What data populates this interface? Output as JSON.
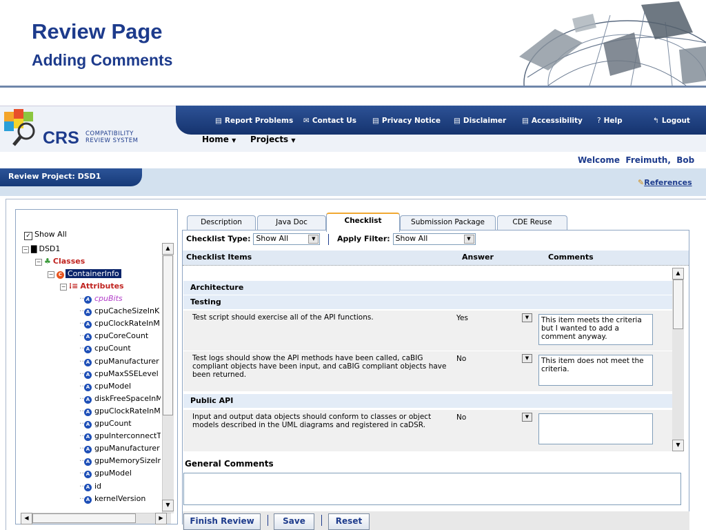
{
  "slide": {
    "title": "Review Page",
    "subtitle": "Adding Comments"
  },
  "brand": {
    "logo_text": "CRS",
    "logo_sub1": "COMPATIBILITY",
    "logo_sub2": "REVIEW SYSTEM",
    "header_blue": "#1d3b8c",
    "nav_blue": "#1f4387"
  },
  "topnav": {
    "report": "Report Problems",
    "contact": "Contact Us",
    "privacy": "Privacy Notice",
    "disclaimer": "Disclaimer",
    "accessibility": "Accessibility",
    "help": "Help",
    "logout": "Logout"
  },
  "menu": {
    "home": "Home",
    "projects": "Projects"
  },
  "welcome": "Welcome  Freimuth,  Bob",
  "project": {
    "title": "Review Project: DSD1",
    "references": "References"
  },
  "tree": {
    "show_all": "Show All",
    "root": "DSD1",
    "classes": "Classes",
    "selected_class": "ContainerInfo",
    "attributes_label": "Attributes",
    "attributes": [
      "cpuBits",
      "cpuCacheSizeInK",
      "cpuClockRateInM",
      "cpuCoreCount",
      "cpuCount",
      "cpuManufacturer",
      "cpuMaxSSELevel",
      "cpuModel",
      "diskFreeSpaceInM",
      "gpuClockRateInM",
      "gpuCount",
      "gpuInterconnectT",
      "gpuManufacturer",
      "gpuMemorySizeIr",
      "gpuModel",
      "id",
      "kernelVersion"
    ]
  },
  "tabs": [
    "Description",
    "Java Doc",
    "Checklist",
    "Submission Package",
    "CDE Reuse"
  ],
  "filters": {
    "type_label": "Checklist Type:",
    "type_value": "Show All",
    "filter_label": "Apply Filter:",
    "filter_value": "Show All"
  },
  "columns": {
    "items": "Checklist Items",
    "answer": "Answer",
    "comments": "Comments"
  },
  "sections": {
    "architecture": "Architecture",
    "testing": "Testing",
    "public_api": "Public API"
  },
  "items": [
    {
      "text": "Test script should exercise all of the API functions.",
      "answer": "Yes",
      "comment": "This item meets the criteria but I wanted to add a comment anyway."
    },
    {
      "text": "Test logs should show the API methods have been called, caBIG compliant objects have been input, and caBIG compliant objects have been returned.",
      "answer": "No",
      "comment": "This item does not meet the criteria."
    },
    {
      "text": "Input and output data objects should conform to classes or object models described in the UML diagrams and registered in caDSR.",
      "answer": "No",
      "comment": ""
    }
  ],
  "general_comments": "General Comments",
  "actions": {
    "finish": "Finish Review",
    "save": "Save",
    "reset": "Reset"
  }
}
